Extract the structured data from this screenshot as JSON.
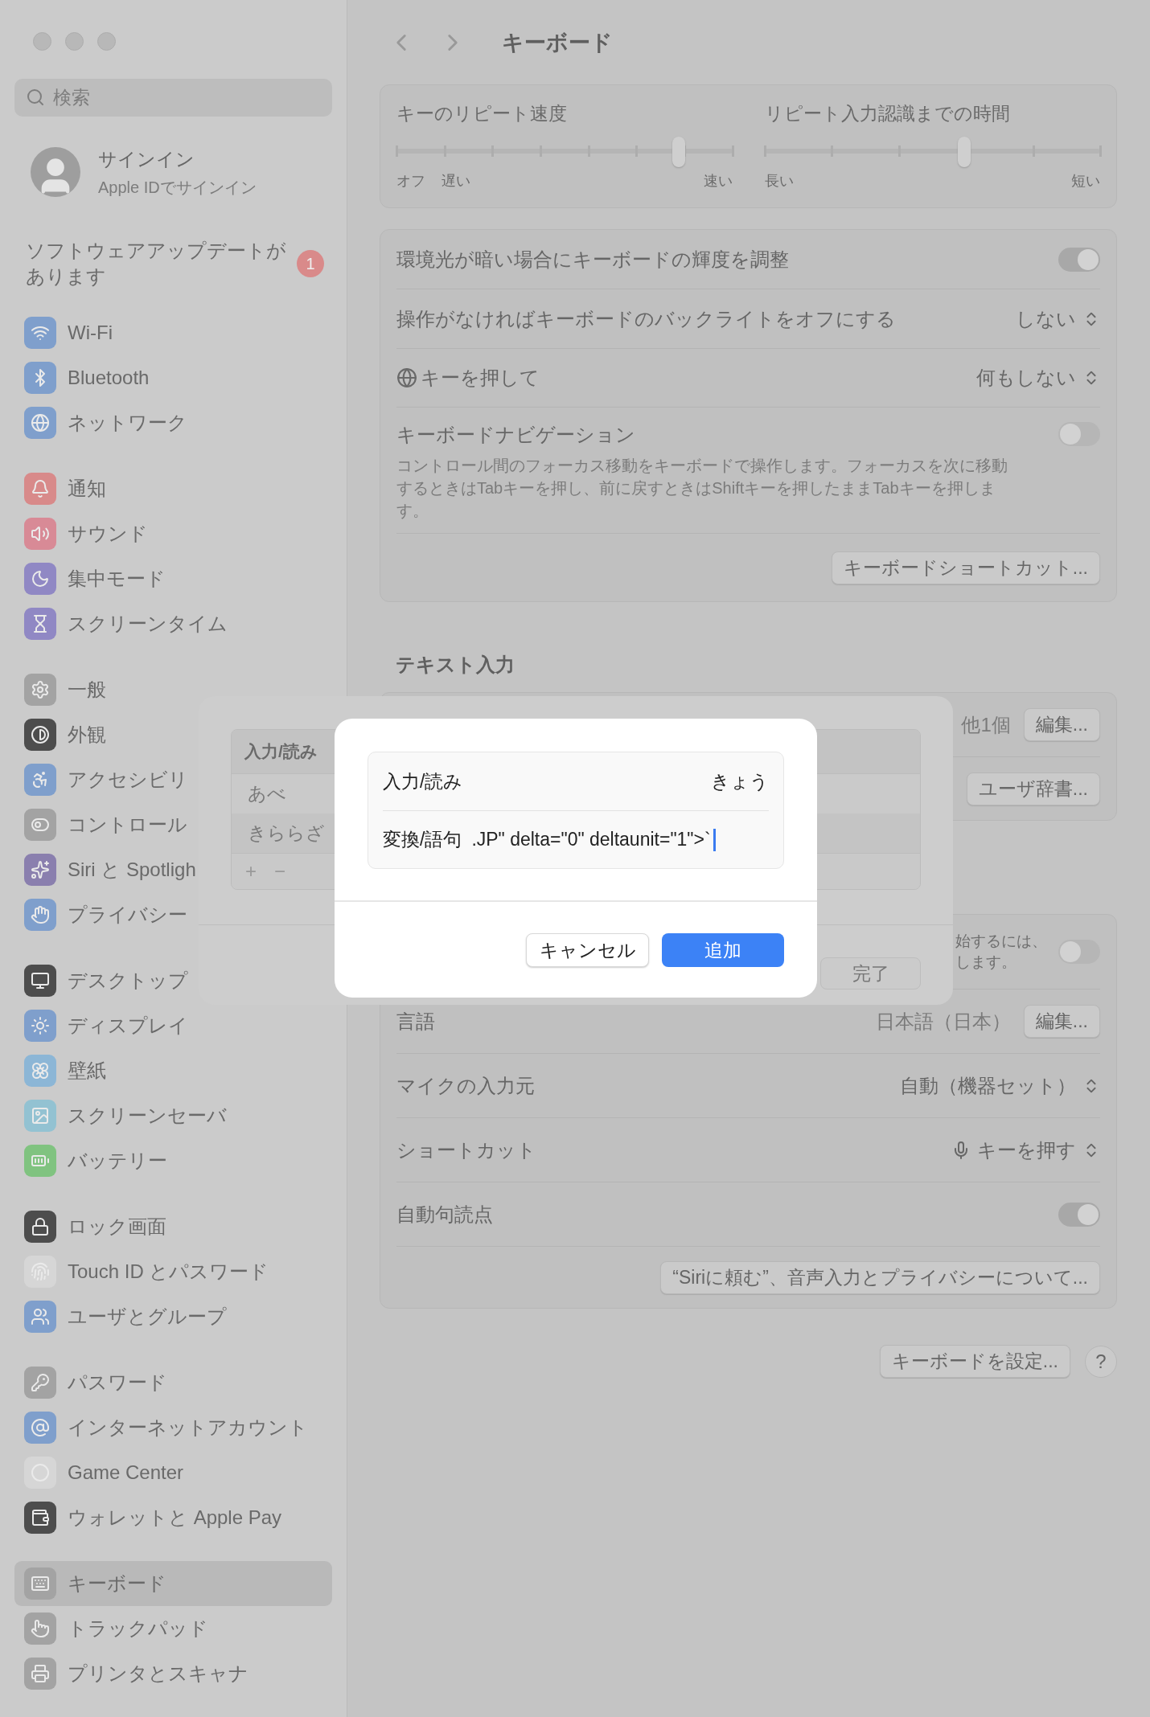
{
  "sidebar": {
    "search": {
      "placeholder": "検索"
    },
    "account": {
      "title": "サインイン",
      "subtitle": "Apple IDでサインイン"
    },
    "update": {
      "label": "ソフトウェアアップデートがあります",
      "badge": "1"
    },
    "groups": [
      {
        "items": [
          {
            "label": "Wi-Fi",
            "color": "#7f9fcc",
            "selected": false
          },
          {
            "label": "Bluetooth",
            "color": "#7f9fcc",
            "selected": false
          },
          {
            "label": "ネットワーク",
            "color": "#7f9fcc",
            "selected": false
          }
        ]
      },
      {
        "items": [
          {
            "label": "通知",
            "color": "#d88a8a",
            "selected": false
          },
          {
            "label": "サウンド",
            "color": "#d88a96",
            "selected": false
          },
          {
            "label": "集中モード",
            "color": "#9088c4",
            "selected": false
          },
          {
            "label": "スクリーンタイム",
            "color": "#9088c4",
            "selected": false
          }
        ]
      },
      {
        "items": [
          {
            "label": "一般",
            "color": "#a3a3a3",
            "selected": false
          },
          {
            "label": "外観",
            "color": "#4d4d4d",
            "selected": false
          },
          {
            "label": "アクセシビリ",
            "color": "#7f9fcc",
            "selected": false
          },
          {
            "label": "コントロール",
            "color": "#a3a3a3",
            "selected": false
          },
          {
            "label": "Siri と Spotligh",
            "color": "#8a7fae",
            "selected": false
          },
          {
            "label": "プライバシー",
            "color": "#7f9fcc",
            "selected": false
          }
        ]
      },
      {
        "items": [
          {
            "label": "デスクトップ",
            "color": "#4d4d4d",
            "selected": false
          },
          {
            "label": "ディスプレイ",
            "color": "#7f9fcc",
            "selected": false
          },
          {
            "label": "壁紙",
            "color": "#8cb6d6",
            "selected": false
          },
          {
            "label": "スクリーンセーバ",
            "color": "#93c2d2",
            "selected": false
          },
          {
            "label": "バッテリー",
            "color": "#80c380",
            "selected": false
          }
        ]
      },
      {
        "items": [
          {
            "label": "ロック画面",
            "color": "#4d4d4d",
            "selected": false
          },
          {
            "label": "Touch ID とパスワード",
            "color": "#d6d6d6",
            "selected": false
          },
          {
            "label": "ユーザとグループ",
            "color": "#7f9fcc",
            "selected": false
          }
        ]
      },
      {
        "items": [
          {
            "label": "パスワード",
            "color": "#a3a3a3",
            "selected": false
          },
          {
            "label": "インターネットアカウント",
            "color": "#7f9fcc",
            "selected": false
          },
          {
            "label": "Game Center",
            "color": "#d6d6d6",
            "selected": false
          },
          {
            "label": "ウォレットと Apple Pay",
            "color": "#4d4d4d",
            "selected": false
          }
        ]
      },
      {
        "items": [
          {
            "label": "キーボード",
            "color": "#a3a3a3",
            "selected": true
          },
          {
            "label": "トラックパッド",
            "color": "#a3a3a3",
            "selected": false
          },
          {
            "label": "プリンタとスキャナ",
            "color": "#a3a3a3",
            "selected": false
          }
        ]
      }
    ]
  },
  "toolbar": {
    "title": "キーボード"
  },
  "sliders": [
    {
      "title": "キーのリピート速度",
      "level": 0.84,
      "labels": [
        "オフ",
        "遅い",
        "速い"
      ]
    },
    {
      "title": "リピート入力認識までの時間",
      "level": 0.595,
      "labels": [
        "長い",
        "短い"
      ]
    }
  ],
  "settings": [
    {
      "kind": "toggle",
      "label": "環境光が暗い場合にキーボードの輝度を調整",
      "on": true
    },
    {
      "kind": "popup",
      "label": "操作がなければキーボードのバックライトをオフにする",
      "value": "しない"
    },
    {
      "kind": "popup",
      "label": "キーを押して",
      "label_icon": true,
      "value": "何もしない"
    },
    {
      "kind": "toggle",
      "label": "キーボードナビゲーション",
      "on": false,
      "description": "コントロール間のフォーカス移動をキーボードで操作します。フォーカスを次に移動するときはTabキーを押し、前に戻すときはShiftキーを押したままTabキーを押します。"
    },
    {
      "kind": "button",
      "button": "キーボードショートカット..."
    }
  ],
  "text_input": {
    "heading": "テキスト入力",
    "rows": [
      {
        "kind": "value_button",
        "value": "他1個",
        "button": "編集..."
      },
      {
        "kind": "button",
        "button": "ユーザ辞書..."
      }
    ]
  },
  "dictation": {
    "rows": [
      {
        "kind": "toggle",
        "fragments": [
          "始するには、",
          "します。"
        ],
        "on": false
      },
      {
        "kind": "value_button",
        "label": "言語",
        "value": "日本語（日本）",
        "button": "編集..."
      },
      {
        "kind": "popup",
        "label": "マイクの入力元",
        "value": "自動（機器セット）"
      },
      {
        "kind": "popup",
        "label": "ショートカット",
        "value": "キーを押す",
        "value_icon": true
      },
      {
        "kind": "toggle",
        "label": "自動句読点",
        "on": true
      },
      {
        "kind": "button",
        "button": "“Siriに頼む”、音声入力とプライバシーについて..."
      }
    ]
  },
  "footer": {
    "setup_button": "キーボードを設定...",
    "help_button": "?"
  },
  "sheet": {
    "column": "入力/読み",
    "rows": [
      "あべ",
      "きららざ"
    ],
    "add": "+",
    "remove": "−",
    "done": "完了"
  },
  "dialog": {
    "reading_label": "入力/読み",
    "reading_value": "きょう",
    "phrase_label": "変換/語句",
    "phrase_value": ".JP\" delta=\"0\" deltaunit=\"1\">`",
    "cancel": "キャンセル",
    "add": "追加"
  }
}
